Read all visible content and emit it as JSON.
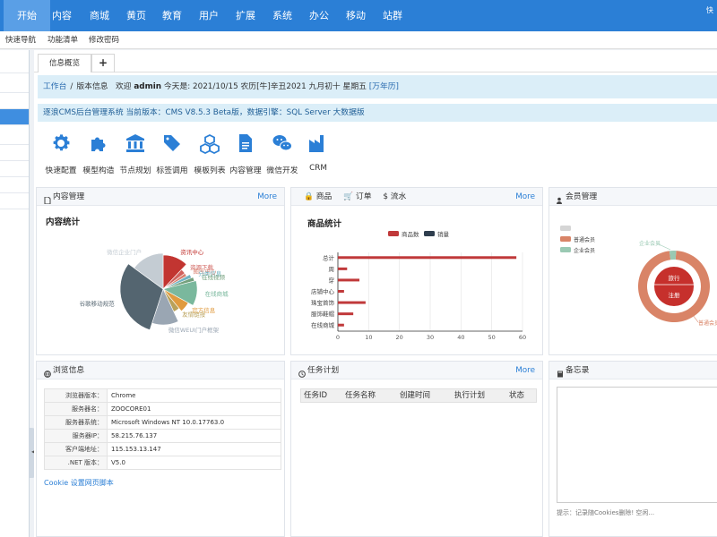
{
  "topnav": {
    "items": [
      "开始",
      "内容",
      "商城",
      "黄页",
      "教育",
      "用户",
      "扩展",
      "系统",
      "办公",
      "移动",
      "站群"
    ],
    "corner": "快"
  },
  "subnav": {
    "items": [
      "快速导航",
      "功能清单",
      "修改密码"
    ]
  },
  "tabs": {
    "current": "信息概览",
    "add": "+"
  },
  "infobar": {
    "breadcrumb_workbench": "工作台",
    "breadcrumb_sep": "/",
    "breadcrumb_version": "版本信息",
    "welcome": "欢迎",
    "user": "admin",
    "today": "今天是: 2021/10/15 农历[牛]辛丑2021 九月初十 星期五",
    "calendar_link": "[万年历]"
  },
  "version_text": "逐浪CMS后台管理系统 当前版本：CMS V8.5.3 Beta版，数据引擎：SQL Server 大数据版",
  "quick": [
    {
      "label": "快速配置",
      "icon": "gear-icon"
    },
    {
      "label": "模型构造",
      "icon": "puzzle-icon"
    },
    {
      "label": "节点规划",
      "icon": "bank-icon"
    },
    {
      "label": "标签调用",
      "icon": "tags-icon"
    },
    {
      "label": "模板列表",
      "icon": "cubes-icon"
    },
    {
      "label": "内容管理",
      "icon": "document-icon"
    },
    {
      "label": "微信开发",
      "icon": "wechat-icon"
    },
    {
      "label": "CRM",
      "icon": "factory-icon"
    }
  ],
  "panels": {
    "content": {
      "title": "内容管理",
      "more": "More",
      "chart_title": "内容统计"
    },
    "shop": {
      "tabs": [
        "商品",
        "订单",
        "流水"
      ],
      "more": "More",
      "chart_title": "商品统计"
    },
    "member": {
      "title": "会员管理"
    },
    "browser": {
      "title": "浏览信息",
      "cookie_link": "Cookie 设置网页脚本"
    },
    "tasks": {
      "title": "任务计划",
      "more": "More",
      "columns": [
        "任务ID",
        "任务名称",
        "创建时间",
        "执行计划",
        "状态"
      ]
    },
    "memo": {
      "title": "备忘录",
      "tip": "提示：记录随Cookies删除! 空闲..."
    }
  },
  "browser_info": [
    {
      "k": "浏览器版本：",
      "v": "Chrome"
    },
    {
      "k": "服务器名：",
      "v": "ZOOCORE01"
    },
    {
      "k": "服务器系统：",
      "v": "Microsoft Windows NT 10.0.17763.0"
    },
    {
      "k": "服务器IP：",
      "v": "58.215.76.137"
    },
    {
      "k": "客户端地址：",
      "v": "115.153.13.147"
    },
    {
      "k": ".NET 版本：",
      "v": "V5.0"
    }
  ],
  "colors": {
    "nav": "#2b7fd6",
    "accent_red": "#c0393a",
    "accent_navy": "#2f3e4e",
    "member_orange": "#d98467",
    "member_green": "#9ac9b3"
  },
  "chart_data": [
    {
      "type": "pie",
      "title": "内容统计",
      "labels": [
        "资讯中心",
        "资源下载",
        "图库中心",
        "分类信息",
        "在线视频",
        "在线商城",
        "官方信息",
        "友情链接",
        "微信WEUI门户框架",
        "谷歌移动规范",
        "微信企业门户"
      ],
      "values": [
        12,
        3,
        2,
        2,
        2,
        12,
        6,
        4,
        12,
        30,
        15
      ],
      "colors": [
        "#c23531",
        "#d0615d",
        "#d8806f",
        "#6fb3c2",
        "#74a07c",
        "#7ab89d",
        "#e09b3f",
        "#b9a15a",
        "#9aa6b3",
        "#546570",
        "#c4ccd3"
      ]
    },
    {
      "type": "bar",
      "title": "商品统计",
      "legend": [
        "商品数",
        "销量"
      ],
      "categories": [
        "总计",
        "周",
        "穿",
        "店铺中心",
        "珠宝首饰",
        "服饰鞋帽",
        "在线商城"
      ],
      "series": [
        {
          "name": "商品数",
          "values": [
            58,
            3,
            7,
            2,
            9,
            5,
            2
          ]
        },
        {
          "name": "销量",
          "values": [
            0,
            0,
            0,
            0,
            0,
            0,
            0
          ]
        }
      ],
      "xticks": [
        0,
        10,
        20,
        30,
        40,
        50,
        60
      ],
      "xlim": [
        0,
        60
      ]
    },
    {
      "type": "pie",
      "title": "会员管理",
      "legend": [
        "普通会员",
        "企业会员"
      ],
      "inner_labels": [
        "旅行",
        "注册"
      ],
      "outer_labels": [
        "企业会员",
        "普通会员"
      ],
      "values": [
        97,
        3
      ]
    }
  ]
}
